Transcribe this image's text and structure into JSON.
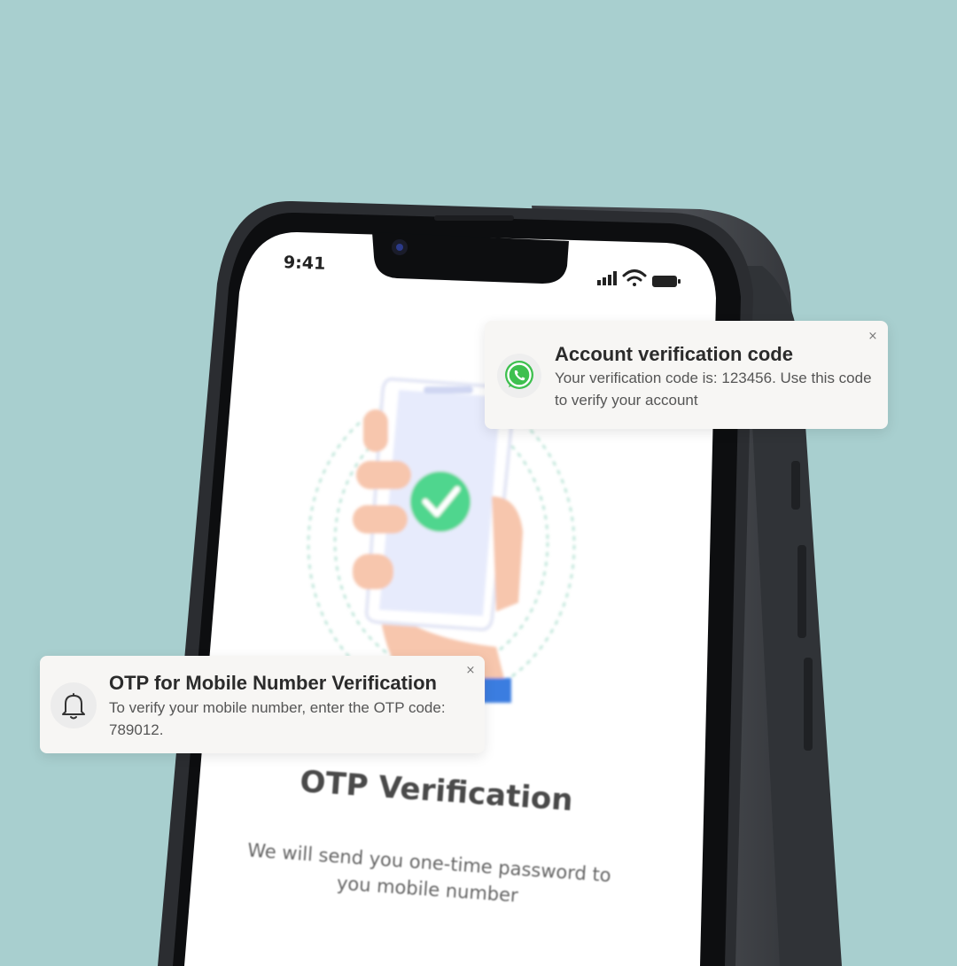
{
  "status_bar": {
    "time": "9:41"
  },
  "screen": {
    "title": "OTP Verification",
    "subtitle": "We will send you one-time password to you mobile number"
  },
  "notifications": [
    {
      "icon": "whatsapp-icon",
      "title": "Account verification code",
      "body": "Your verification code is: 123456. Use this code to verify your account",
      "close_label": "×"
    },
    {
      "icon": "bell-icon",
      "title": "OTP for Mobile Number Verification",
      "body": "To verify your mobile number, enter the OTP code: 789012.",
      "close_label": "×"
    }
  ],
  "colors": {
    "background": "#a8cfcf",
    "whatsapp_green": "#3ec04f",
    "check_green": "#4fd68e",
    "phone_body": "#2f3236",
    "card_bg": "#f7f6f4"
  }
}
